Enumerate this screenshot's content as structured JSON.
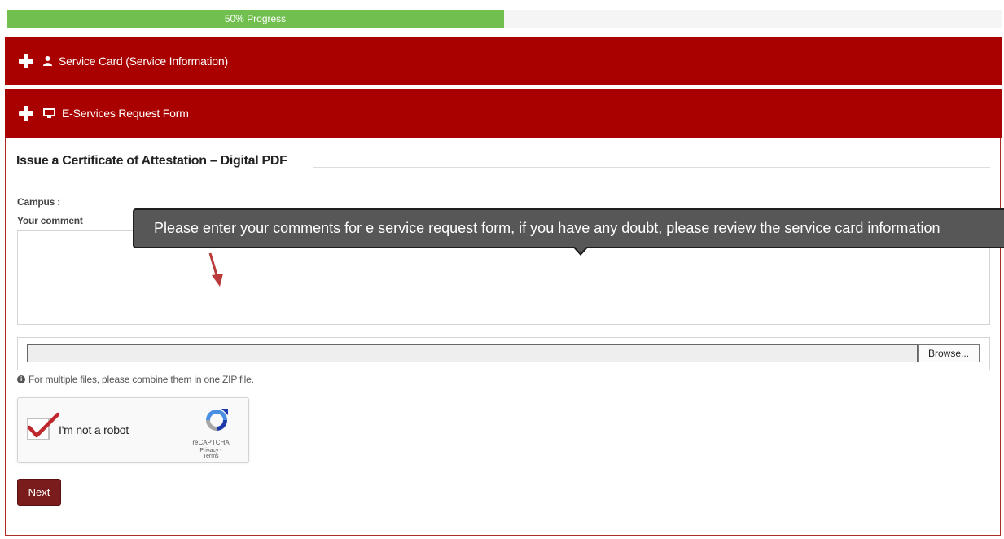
{
  "progress": {
    "label": "50% Progress",
    "value_percent": 50,
    "color": "#71bf4e"
  },
  "panels": {
    "service_card": {
      "label": "Service Card (Service Information)",
      "icon": "user-icon"
    },
    "request_form": {
      "label": "E-Services Request Form",
      "icon": "monitor-icon"
    }
  },
  "form": {
    "title": "Issue a Certificate of Attestation – Digital PDF",
    "campus_label": "Campus :",
    "comment_label": "Your comment",
    "comment_value": "",
    "tooltip": "Please enter your comments for e service request form, if you have any doubt, please review the service card information",
    "file_path_value": "",
    "browse_label": "Browse...",
    "file_hint": "For multiple files, please combine them in one ZIP file.",
    "next_label": "Next"
  },
  "captcha": {
    "label": "I'm not a robot",
    "checked": true,
    "brand": "reCAPTCHA",
    "links": "Privacy - Terms"
  },
  "colors": {
    "header": "#a90000",
    "next_button": "#7a1c1c",
    "annotation": "#b83a3a"
  }
}
